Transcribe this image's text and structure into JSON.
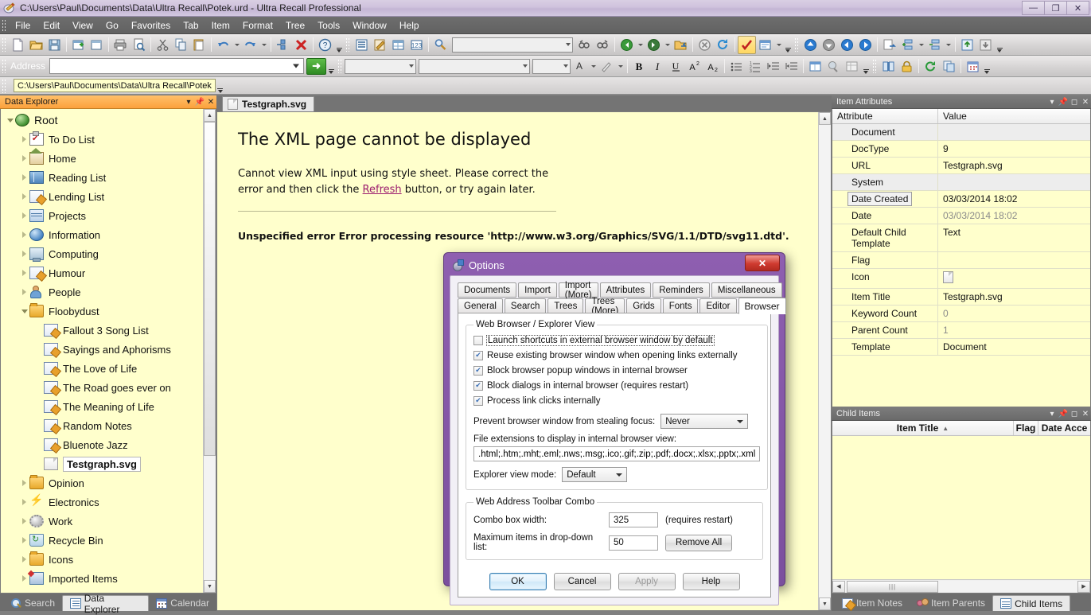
{
  "window": {
    "title": "C:\\Users\\Paul\\Documents\\Data\\Ultra Recall\\Potek.urd - Ultra Recall Professional",
    "minimize": "—",
    "maximize": "❐",
    "close": "✕"
  },
  "menu": {
    "items": [
      "File",
      "Edit",
      "View",
      "Go",
      "Favorites",
      "Tab",
      "Item",
      "Format",
      "Tree",
      "Tools",
      "Window",
      "Help"
    ]
  },
  "toolbars": {
    "row1_icons": [
      "new-document-icon",
      "open-folder-icon",
      "save-icon",
      "new-item-icon",
      "new-sibling-icon",
      "print-icon",
      "print-preview-icon",
      "cut-icon",
      "copy-icon",
      "paste-icon",
      "undo-icon",
      "redo-icon",
      "properties-icon",
      "delete-icon",
      "help-icon"
    ],
    "row1b_icons": [
      "explorer-icon",
      "notes-icon",
      "attributes-icon",
      "keywords-icon",
      "search-magnifier-icon"
    ],
    "search_value": "",
    "nav_icons": [
      "find-prev-icon",
      "find-next-icon",
      "back-icon",
      "forward-icon",
      "open-external-icon",
      "stop-icon",
      "refresh-icon",
      "flag-icon",
      "reading-list-icon"
    ],
    "row1c_icons": [
      "move-up-icon",
      "move-down-icon",
      "move-left-icon",
      "move-right-icon",
      "export-icon",
      "expand-icon",
      "collapse-icon",
      "promote-icon",
      "demote-icon"
    ],
    "font_name": "",
    "font_size": "",
    "font_style": "",
    "format_icons": [
      "font-color-icon",
      "highlight-icon",
      "bold-icon",
      "italic-icon",
      "underline-icon",
      "superscript-icon",
      "subscript-icon",
      "bullet-list-icon",
      "number-list-icon",
      "decrease-indent-icon",
      "increase-indent-icon",
      "insert-table-icon",
      "insert-link-icon",
      "table-props-icon"
    ],
    "row2c_icons": [
      "dictionary-icon",
      "lock-icon",
      "sync-icon",
      "duplicate-icon",
      "calendar-icon"
    ]
  },
  "address": {
    "label": "Address",
    "value": "",
    "placeholder": "",
    "go_label": "➜"
  },
  "pathbar": {
    "value": "C:\\Users\\Paul\\Documents\\Data\\Ultra Recall\\Potek"
  },
  "data_explorer": {
    "caption": "Data Explorer",
    "caption_buttons": [
      "menu-chevron",
      "pin",
      "close"
    ],
    "tree": [
      {
        "label": "Root",
        "depth": 0,
        "icon": "globe-icon",
        "expander": "expanded",
        "selected": false
      },
      {
        "label": "To Do List",
        "depth": 1,
        "icon": "todo-clipboard-icon",
        "expander": "collapsed",
        "selected": false
      },
      {
        "label": "Home",
        "depth": 1,
        "icon": "home-icon",
        "expander": "collapsed",
        "selected": false
      },
      {
        "label": "Reading List",
        "depth": 1,
        "icon": "book-icon",
        "expander": "collapsed",
        "selected": false
      },
      {
        "label": "Lending List",
        "depth": 1,
        "icon": "note-icon",
        "expander": "collapsed",
        "selected": false
      },
      {
        "label": "Projects",
        "depth": 1,
        "icon": "projects-icon",
        "expander": "collapsed",
        "selected": false
      },
      {
        "label": "Information",
        "depth": 1,
        "icon": "info-icon",
        "expander": "collapsed",
        "selected": false
      },
      {
        "label": "Computing",
        "depth": 1,
        "icon": "computer-icon",
        "expander": "collapsed",
        "selected": false
      },
      {
        "label": "Humour",
        "depth": 1,
        "icon": "note-icon",
        "expander": "collapsed",
        "selected": false
      },
      {
        "label": "People",
        "depth": 1,
        "icon": "person-icon",
        "expander": "collapsed",
        "selected": false
      },
      {
        "label": "Floobydust",
        "depth": 1,
        "icon": "folder-icon",
        "expander": "expanded",
        "selected": false
      },
      {
        "label": "Fallout 3 Song List",
        "depth": 2,
        "icon": "note-icon",
        "expander": "none",
        "selected": false
      },
      {
        "label": "Sayings and Aphorisms",
        "depth": 2,
        "icon": "note-icon",
        "expander": "none",
        "selected": false
      },
      {
        "label": "The Love of Life",
        "depth": 2,
        "icon": "note-icon",
        "expander": "none",
        "selected": false
      },
      {
        "label": "The Road goes ever on",
        "depth": 2,
        "icon": "note-icon",
        "expander": "none",
        "selected": false
      },
      {
        "label": "The Meaning of Life",
        "depth": 2,
        "icon": "note-icon",
        "expander": "none",
        "selected": false
      },
      {
        "label": "Random Notes",
        "depth": 2,
        "icon": "note-icon",
        "expander": "none",
        "selected": false
      },
      {
        "label": "Bluenote Jazz",
        "depth": 2,
        "icon": "note-icon",
        "expander": "none",
        "selected": false
      },
      {
        "label": "Testgraph.svg",
        "depth": 2,
        "icon": "document-page-icon",
        "expander": "none",
        "selected": true
      },
      {
        "label": "Opinion",
        "depth": 1,
        "icon": "folder-icon",
        "expander": "collapsed",
        "selected": false
      },
      {
        "label": "Electronics",
        "depth": 1,
        "icon": "bolt-icon",
        "expander": "collapsed",
        "selected": false
      },
      {
        "label": "Work",
        "depth": 1,
        "icon": "gear-icon",
        "expander": "collapsed",
        "selected": false
      },
      {
        "label": "Recycle Bin",
        "depth": 1,
        "icon": "recycle-bin-icon",
        "expander": "collapsed",
        "selected": false
      },
      {
        "label": "Icons",
        "depth": 1,
        "icon": "folder-icon",
        "expander": "collapsed",
        "selected": false
      },
      {
        "label": "Imported Items",
        "depth": 1,
        "icon": "imported-items-icon",
        "expander": "collapsed",
        "selected": false
      }
    ],
    "tabs": [
      {
        "label": "Search",
        "icon": "search-icon",
        "active": false
      },
      {
        "label": "Data Explorer",
        "icon": "explorer-icon",
        "active": true
      },
      {
        "label": "Calendar",
        "icon": "calendar-icon",
        "active": false
      }
    ]
  },
  "document": {
    "tab_label": "Testgraph.svg",
    "tab_icon": "document-page-icon",
    "heading": "The XML page cannot be displayed",
    "body_part1": "Cannot view XML input using style sheet. Please correct the error and then click the ",
    "body_link": "Refresh",
    "body_part2": " button, or try again later.",
    "detail": "Unspecified error Error processing resource 'http://www.w3.org/Graphics/SVG/1.1/DTD/svg11.dtd'."
  },
  "item_attributes": {
    "caption": "Item Attributes",
    "columns": [
      "Attribute",
      "Value"
    ],
    "rows": [
      {
        "attribute": "Document",
        "value": "",
        "section": true,
        "selected": false,
        "dim": false
      },
      {
        "attribute": "DocType",
        "value": "9",
        "section": false,
        "selected": false,
        "dim": false
      },
      {
        "attribute": "URL",
        "value": "Testgraph.svg",
        "section": false,
        "selected": false,
        "dim": false
      },
      {
        "attribute": "System",
        "value": "",
        "section": true,
        "selected": false,
        "dim": false
      },
      {
        "attribute": "Date Created",
        "value": "03/03/2014 18:02",
        "section": false,
        "selected": true,
        "dim": false
      },
      {
        "attribute": "Date",
        "value": "03/03/2014 18:02",
        "section": false,
        "selected": false,
        "dim": true
      },
      {
        "attribute": "Default Child Template",
        "value": "Text",
        "section": false,
        "selected": false,
        "dim": false
      },
      {
        "attribute": "Flag",
        "value": "",
        "section": false,
        "selected": false,
        "dim": false
      },
      {
        "attribute": "Icon",
        "value": "",
        "section": false,
        "selected": false,
        "dim": false,
        "icon": "document-page-icon"
      },
      {
        "attribute": "Item Title",
        "value": "Testgraph.svg",
        "section": false,
        "selected": false,
        "dim": false
      },
      {
        "attribute": "Keyword Count",
        "value": "0",
        "section": false,
        "selected": false,
        "dim": true
      },
      {
        "attribute": "Parent Count",
        "value": "1",
        "section": false,
        "selected": false,
        "dim": true
      },
      {
        "attribute": "Template",
        "value": "Document",
        "section": false,
        "selected": false,
        "dim": false
      }
    ]
  },
  "child_items": {
    "caption": "Child Items",
    "columns": [
      "Item Title",
      "Flag",
      "Date Acce"
    ],
    "sort_indicator": "▲",
    "rows": [],
    "tabs": [
      {
        "label": "Item Notes",
        "icon": "notes-icon",
        "active": false
      },
      {
        "label": "Item Parents",
        "icon": "people-icon",
        "active": false
      },
      {
        "label": "Child Items",
        "icon": "grid-icon",
        "active": true
      }
    ]
  },
  "options_dialog": {
    "title": "Options",
    "close_label": "✕",
    "tabs_row1": [
      "Documents",
      "Import",
      "Import (More)",
      "Attributes",
      "Reminders",
      "Miscellaneous"
    ],
    "tabs_row2": [
      "General",
      "Search",
      "Trees",
      "Trees (More)",
      "Grids",
      "Fonts",
      "Editor",
      "Browser"
    ],
    "active_tab": "Browser",
    "group1_legend": "Web Browser / Explorer View",
    "checkboxes": [
      {
        "label": "Launch shortcuts in external browser window by default",
        "checked": false,
        "focused": true
      },
      {
        "label": "Reuse existing browser window when opening links externally",
        "checked": true,
        "focused": false
      },
      {
        "label": "Block browser popup windows in internal browser",
        "checked": true,
        "focused": false
      },
      {
        "label": "Block dialogs in internal browser (requires restart)",
        "checked": true,
        "focused": false
      },
      {
        "label": "Process link clicks internally",
        "checked": true,
        "focused": false
      }
    ],
    "focus_label": "Prevent browser window from stealing focus:",
    "focus_value": "Never",
    "extensions_label": "File extensions to display in internal browser view:",
    "extensions_value": ".html;.htm;.mht;.eml;.nws;.msg;.ico;.gif;.zip;.pdf;.docx;.xlsx;.pptx;.xml",
    "viewmode_label": "Explorer view mode:",
    "viewmode_value": "Default",
    "group2_legend": "Web Address Toolbar Combo",
    "combowidth_label": "Combo box width:",
    "combowidth_value": "325",
    "combowidth_note": "(requires restart)",
    "maxitems_label": "Maximum items in drop-down list:",
    "maxitems_value": "50",
    "remove_all_label": "Remove All",
    "ok_label": "OK",
    "cancel_label": "Cancel",
    "apply_label": "Apply",
    "help_label": "Help"
  }
}
